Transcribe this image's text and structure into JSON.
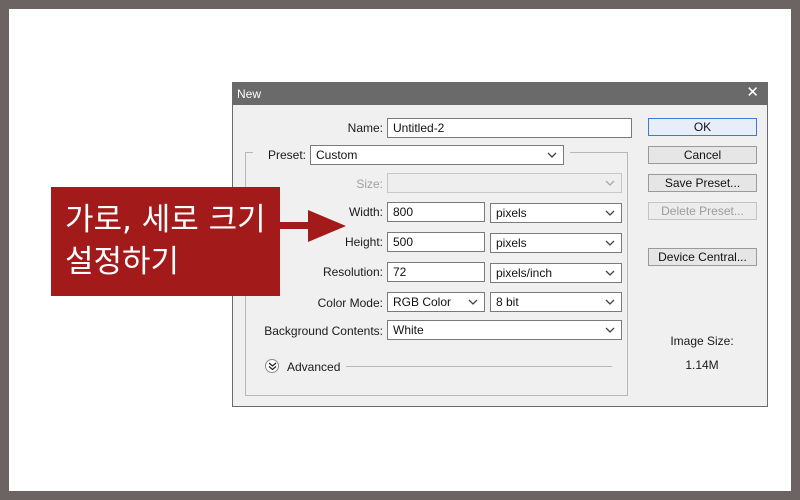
{
  "dialog": {
    "title": "New",
    "close_symbol": "✕"
  },
  "form": {
    "name_label": "Name:",
    "name_value": "Untitled-2",
    "preset_label": "Preset:",
    "preset_value": "Custom",
    "size_label": "Size:",
    "size_value": "",
    "width_label": "Width:",
    "width_value": "800",
    "width_unit": "pixels",
    "height_label": "Height:",
    "height_value": "500",
    "height_unit": "pixels",
    "resolution_label": "Resolution:",
    "resolution_value": "72",
    "resolution_unit": "pixels/inch",
    "color_mode_label": "Color Mode:",
    "color_mode_value": "RGB Color",
    "bit_depth_value": "8 bit",
    "background_label": "Background Contents:",
    "background_value": "White",
    "advanced_label": "Advanced"
  },
  "buttons": {
    "ok": "OK",
    "cancel": "Cancel",
    "save_preset": "Save Preset...",
    "delete_preset": "Delete Preset...",
    "device_central": "Device Central..."
  },
  "image_size": {
    "label": "Image Size:",
    "value": "1.14M"
  },
  "annotation": {
    "line1": "가로, 세로 크기",
    "line2": "설정하기",
    "color": "#a31a1a"
  },
  "colors": {
    "frame": "#6b6463",
    "titlebar": "#6a6a6a",
    "dialog_bg": "#f0f0f0",
    "ok_border": "#3a7bd5"
  }
}
